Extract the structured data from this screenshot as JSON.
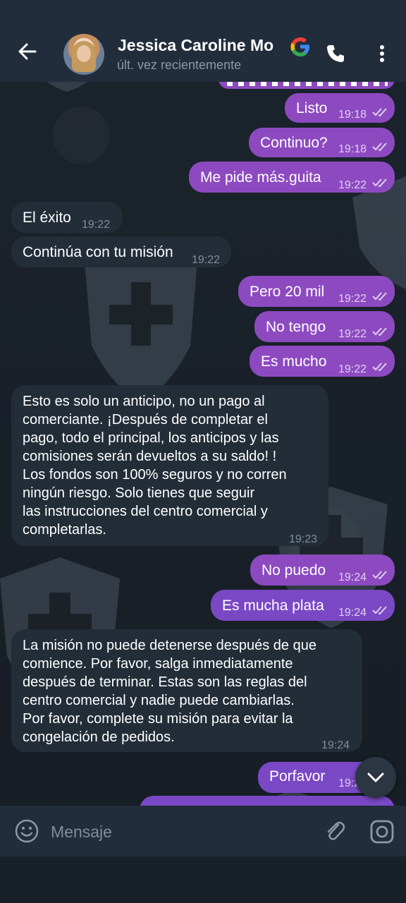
{
  "header": {
    "contact_name": "Jessica Caroline Mo",
    "status": "últ. vez recientemente",
    "icons": {
      "back": "arrow-left-icon",
      "call": "phone-icon",
      "menu": "more-vertical-icon",
      "badge": "google-icon"
    }
  },
  "messages": [
    {
      "dir": "out",
      "text": "Listo",
      "time": "19:18",
      "read": true
    },
    {
      "dir": "out",
      "text": "Continuo?",
      "time": "19:18",
      "read": true
    },
    {
      "dir": "out",
      "text": "Me pide más.guita",
      "time": "19:22",
      "read": true
    },
    {
      "dir": "in",
      "text": "El éxito",
      "time": "19:22"
    },
    {
      "dir": "in",
      "text": "Continúa con tu misión",
      "time": "19:22"
    },
    {
      "dir": "out",
      "text": "Pero 20 mil",
      "time": "19:22",
      "read": true
    },
    {
      "dir": "out",
      "text": "No tengo",
      "time": "19:22",
      "read": true
    },
    {
      "dir": "out",
      "text": "Es mucho",
      "time": "19:22",
      "read": true
    },
    {
      "dir": "in",
      "text": "Esto es solo un anticipo, no un pago al\ncomerciante. ¡Después de completar el\npago, todo el principal, los anticipos y las\ncomisiones serán devueltos a su saldo! !\nLos fondos son 100% seguros y no corren\nningún riesgo. Solo tienes que seguir\nlas instrucciones del centro comercial y\ncompletarlas.",
      "time": "19:23"
    },
    {
      "dir": "out",
      "text": "No puedo",
      "time": "19:24",
      "read": true
    },
    {
      "dir": "out",
      "text": "Es mucha plata",
      "time": "19:24",
      "read": true
    },
    {
      "dir": "in",
      "text": "La misión no puede detenerse después de que\ncomience. Por favor, salga inmediatamente\ndespués de terminar. Estas son las reglas del\ncentro comercial y nadie puede cambiarlas.\nPor favor, complete su misión para evitar la\ncongelación de pedidos.",
      "time": "19:24"
    },
    {
      "dir": "out",
      "text": "Porfavor",
      "time": "19:2",
      "read": true
    }
  ],
  "input": {
    "placeholder": "Mensaje",
    "icons": {
      "emoji": "emoji-icon",
      "attach": "paperclip-icon",
      "extra": "instagram-icon"
    }
  },
  "scroll_button": {
    "icon": "chevron-down-icon"
  },
  "colors": {
    "background": "#182028",
    "header": "#212d3b",
    "outgoing_bubble": "#8d4ac0",
    "incoming_bubble": "#222d38"
  }
}
